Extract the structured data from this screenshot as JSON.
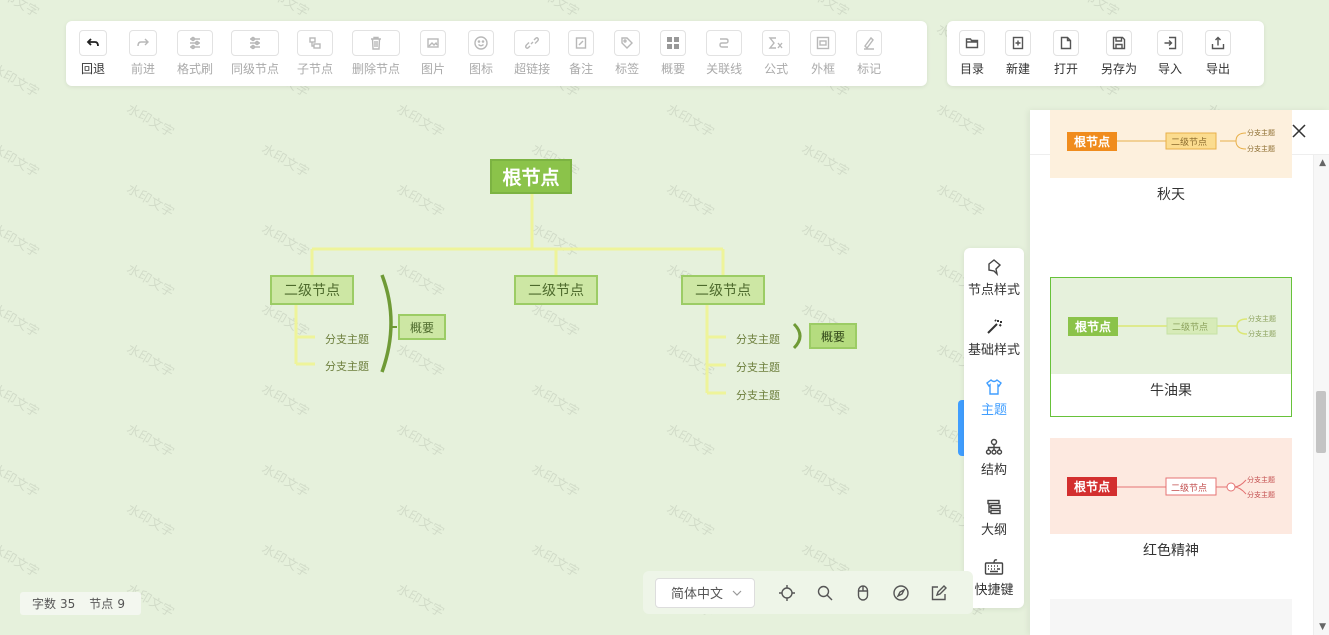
{
  "watermark_text": "水印文字",
  "toolbar_left": [
    {
      "label": "回退",
      "icon": "undo-icon",
      "disabled": false
    },
    {
      "label": "前进",
      "icon": "redo-icon",
      "disabled": true
    },
    {
      "label": "格式刷",
      "icon": "format-brush-icon",
      "disabled": true
    },
    {
      "label": "同级节点",
      "icon": "sibling-node-icon",
      "disabled": true
    },
    {
      "label": "子节点",
      "icon": "child-node-icon",
      "disabled": true
    },
    {
      "label": "删除节点",
      "icon": "delete-node-icon",
      "disabled": true
    },
    {
      "label": "图片",
      "icon": "image-icon",
      "disabled": true
    },
    {
      "label": "图标",
      "icon": "emoji-icon",
      "disabled": true
    },
    {
      "label": "超链接",
      "icon": "link-icon",
      "disabled": true
    },
    {
      "label": "备注",
      "icon": "note-icon",
      "disabled": true
    },
    {
      "label": "标签",
      "icon": "tag-icon",
      "disabled": true
    },
    {
      "label": "概要",
      "icon": "summary-icon",
      "disabled": true
    },
    {
      "label": "关联线",
      "icon": "association-line-icon",
      "disabled": true
    },
    {
      "label": "公式",
      "icon": "formula-icon",
      "disabled": true
    },
    {
      "label": "外框",
      "icon": "outer-frame-icon",
      "disabled": true
    },
    {
      "label": "标记",
      "icon": "mark-icon",
      "disabled": true
    }
  ],
  "toolbar_right": [
    {
      "label": "目录",
      "icon": "folder-icon"
    },
    {
      "label": "新建",
      "icon": "new-file-icon"
    },
    {
      "label": "打开",
      "icon": "open-file-icon"
    },
    {
      "label": "另存为",
      "icon": "save-as-icon"
    },
    {
      "label": "导入",
      "icon": "import-icon"
    },
    {
      "label": "导出",
      "icon": "export-icon"
    }
  ],
  "mindmap": {
    "root": "根节点",
    "second_level": [
      "二级节点",
      "二级节点",
      "二级节点"
    ],
    "branch_topic": "分支主题",
    "summary_label": "概要"
  },
  "panel": {
    "title": "主题",
    "themes": [
      {
        "name": "秋天",
        "bg": "#fdf0dd",
        "root_color": "#f08c1d",
        "line": "#e8b04a",
        "selected": false
      },
      {
        "name": "牛油果",
        "bg": "#e6f1dc",
        "root_color": "#8bc34a",
        "line": "#dce775",
        "selected": true
      },
      {
        "name": "红色精神",
        "bg": "#fde9e0",
        "root_color": "#d32f2f",
        "line": "#e57373",
        "selected": false
      }
    ],
    "preview_root": "根节点",
    "preview_second": "二级节点",
    "preview_branch": "分支主题"
  },
  "right_nav": [
    {
      "label": "节点样式",
      "icon": "node-style-icon",
      "active": false
    },
    {
      "label": "基础样式",
      "icon": "magic-wand-icon",
      "active": false
    },
    {
      "label": "主题",
      "icon": "shirt-icon",
      "active": true
    },
    {
      "label": "结构",
      "icon": "structure-icon",
      "active": false
    },
    {
      "label": "大纲",
      "icon": "outline-icon",
      "active": false
    },
    {
      "label": "快捷键",
      "icon": "keyboard-icon",
      "active": false
    }
  ],
  "bottom_bar": {
    "language": "简体中文",
    "icons": [
      "locate-icon",
      "search-icon",
      "mouse-icon",
      "navigator-icon",
      "edit-icon"
    ]
  },
  "stats": {
    "word_label": "字数",
    "word_count": "35",
    "node_label": "节点",
    "node_count": "9"
  },
  "colors": {
    "canvas_bg": "#e6f1dc",
    "root_bg": "#8bc34a",
    "second_bg": "#cde7a4",
    "line": "#eef49a",
    "summary_brace": "#6f9a36",
    "active_blue": "#409eff"
  }
}
